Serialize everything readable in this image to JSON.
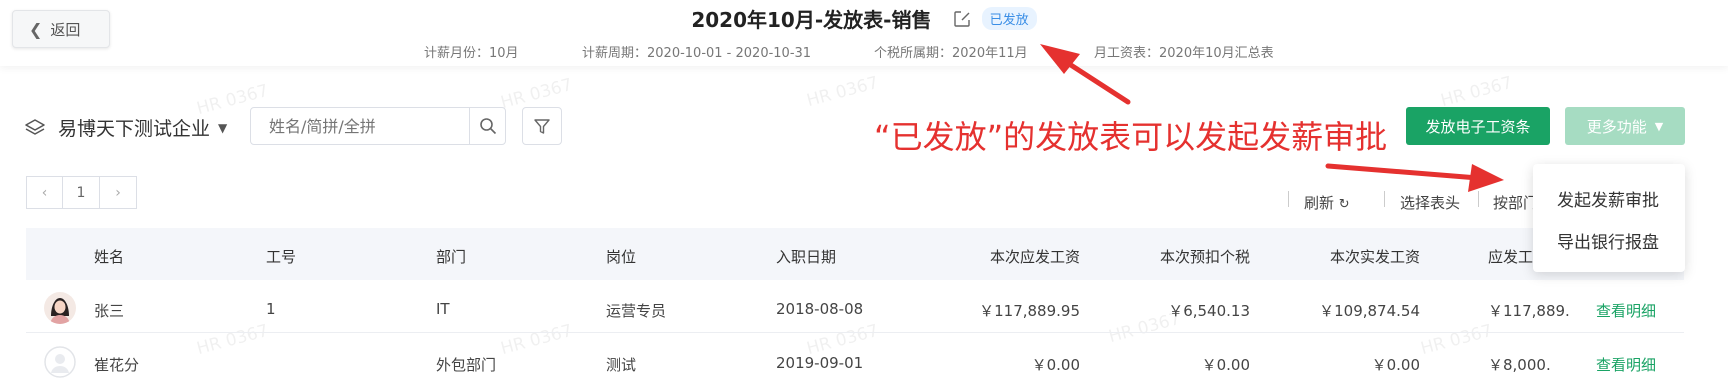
{
  "header": {
    "back_label": "返回",
    "title": "2020年10月-发放表-销售",
    "status": "已发放",
    "meta": {
      "salary_month": "计薪月份：10月",
      "salary_period": "计薪周期：2020-10-01 - 2020-10-31",
      "tax_period": "个税所属期：2020年11月",
      "monthly_salary": "月工资表：2020年10月汇总表"
    }
  },
  "toolbar": {
    "company": "易博天下测试企业",
    "search_placeholder": "姓名/简拼/全拼",
    "issue_payslip": "发放电子工资条",
    "more_functions": "更多功能"
  },
  "annotation": "“已发放”的发放表可以发起发薪审批",
  "dropdown": {
    "items": [
      "发起发薪审批",
      "导出银行报盘"
    ]
  },
  "pager": {
    "prev": "‹",
    "page": "1",
    "next": "›"
  },
  "table_actions": {
    "refresh": "刷新",
    "select_header": "选择表头",
    "by_department": "按部门"
  },
  "table": {
    "columns": [
      "姓名",
      "工号",
      "部门",
      "岗位",
      "入职日期",
      "本次应发工资",
      "本次预扣个税",
      "本次实发工资",
      "应发工"
    ],
    "rows": [
      {
        "name": "张三",
        "id": "1",
        "dept": "IT",
        "position": "运营专员",
        "hire_date": "2018-08-08",
        "gross": "￥117,889.95",
        "tax": "￥6,540.13",
        "net": "￥109,874.54",
        "gross2": "￥117,889.",
        "action": "查看明细"
      },
      {
        "name": "崔花分",
        "id": "",
        "dept": "外包部门",
        "position": "测试",
        "hire_date": "2019-09-01",
        "gross": "￥0.00",
        "tax": "￥0.00",
        "net": "￥0.00",
        "gross2": "￥8,000.",
        "action": "查看明细"
      }
    ]
  },
  "colors": {
    "accent_green": "#1aa365",
    "annotation_red": "#e5312f",
    "badge_blue": "#3a8ee6"
  },
  "watermark": "HR 0367"
}
